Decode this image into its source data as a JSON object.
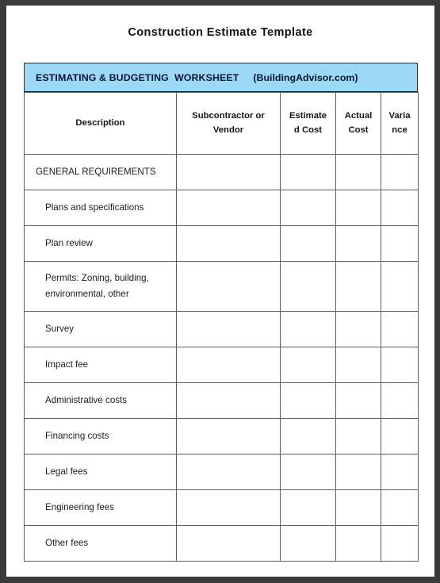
{
  "document": {
    "title": "Construction Estimate Template"
  },
  "worksheet": {
    "banner_title": "ESTIMATING & BUDGETING  WORKSHEET",
    "banner_site": "(BuildingAdvisor.com)",
    "banner_color": "#9BD9F7",
    "columns": [
      {
        "key": "description",
        "label": "Description"
      },
      {
        "key": "subcontractor",
        "label_line1": "Subcontractor  or",
        "label_line2": "Vendor"
      },
      {
        "key": "estimated_cost",
        "label_line1": "Estimate",
        "label_line2": "d Cost"
      },
      {
        "key": "actual_cost",
        "label_line1": "Actual",
        "label_line2": "Cost"
      },
      {
        "key": "variance",
        "label_line1": "Varia",
        "label_line2": "nce"
      }
    ],
    "rows": [
      {
        "description": "GENERAL REQUIREMENTS",
        "indented": false,
        "tall": false,
        "subcontractor": "",
        "estimated_cost": "",
        "actual_cost": "",
        "variance": ""
      },
      {
        "description": "Plans and specifications",
        "indented": true,
        "tall": false,
        "subcontractor": "",
        "estimated_cost": "",
        "actual_cost": "",
        "variance": ""
      },
      {
        "description": "Plan review",
        "indented": true,
        "tall": false,
        "subcontractor": "",
        "estimated_cost": "",
        "actual_cost": "",
        "variance": ""
      },
      {
        "description": "Permits:  Zoning, building,",
        "description_line2": "environmental,  other",
        "indented": true,
        "tall": true,
        "subcontractor": "",
        "estimated_cost": "",
        "actual_cost": "",
        "variance": ""
      },
      {
        "description": "Survey",
        "indented": true,
        "tall": false,
        "subcontractor": "",
        "estimated_cost": "",
        "actual_cost": "",
        "variance": ""
      },
      {
        "description": "Impact fee",
        "indented": true,
        "tall": false,
        "subcontractor": "",
        "estimated_cost": "",
        "actual_cost": "",
        "variance": ""
      },
      {
        "description": "Administrative costs",
        "indented": true,
        "tall": false,
        "subcontractor": "",
        "estimated_cost": "",
        "actual_cost": "",
        "variance": ""
      },
      {
        "description": "Financing costs",
        "indented": true,
        "tall": false,
        "subcontractor": "",
        "estimated_cost": "",
        "actual_cost": "",
        "variance": ""
      },
      {
        "description": "Legal fees",
        "indented": true,
        "tall": false,
        "subcontractor": "",
        "estimated_cost": "",
        "actual_cost": "",
        "variance": ""
      },
      {
        "description": "Engineering fees",
        "indented": true,
        "tall": false,
        "subcontractor": "",
        "estimated_cost": "",
        "actual_cost": "",
        "variance": ""
      },
      {
        "description": "Other fees",
        "indented": true,
        "tall": false,
        "subcontractor": "",
        "estimated_cost": "",
        "actual_cost": "",
        "variance": ""
      }
    ]
  }
}
